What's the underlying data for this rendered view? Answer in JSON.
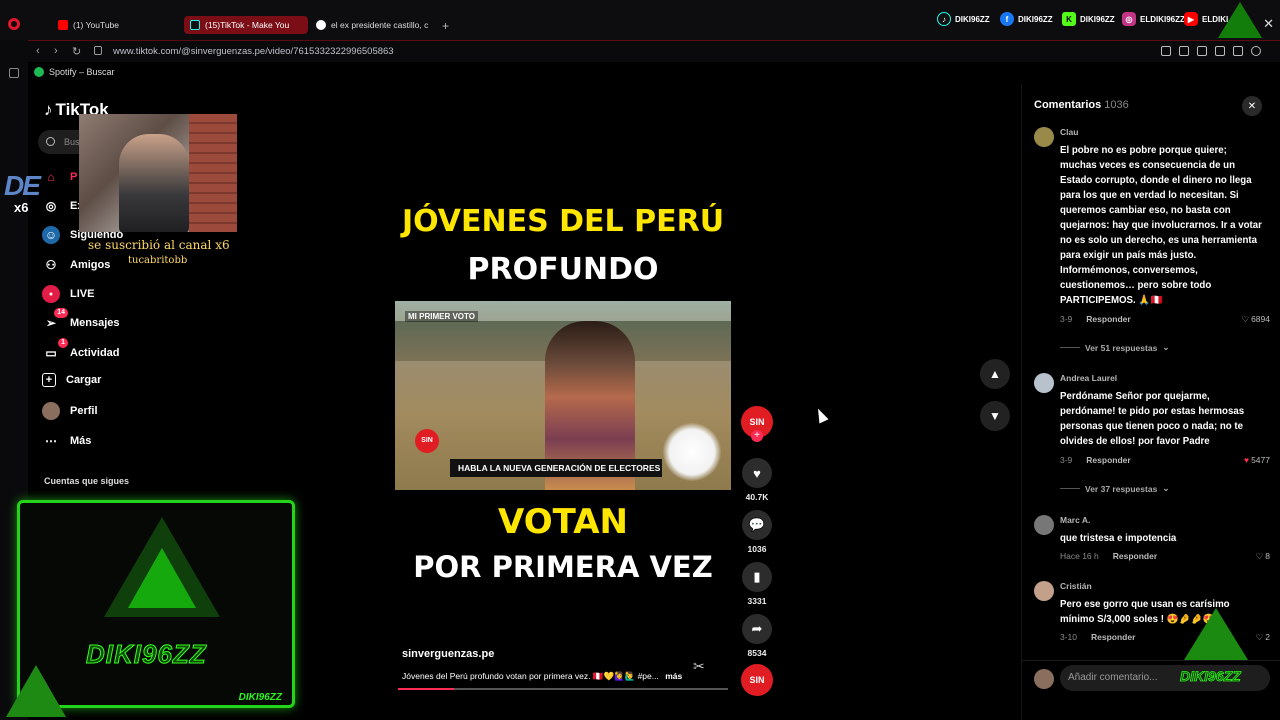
{
  "browser": {
    "tabs": [
      {
        "label": "(1) YouTube",
        "icon": "youtube-icon",
        "active": false
      },
      {
        "label": "(15)TikTok - Make You",
        "icon": "tiktok-icon",
        "active": true
      },
      {
        "label": "el ex presidente castillo, c",
        "icon": "google-icon",
        "active": false
      }
    ],
    "url": "www.tiktok.com/@sinverguenzas.pe/video/7615332322996505863",
    "bookmark": "Spotify – Buscar",
    "socials": [
      {
        "icon": "tiktok-icon",
        "label": "DIKI96ZZ",
        "color": "#111111"
      },
      {
        "icon": "facebook-icon",
        "label": "DIKI96ZZ",
        "color": "#1877f2"
      },
      {
        "icon": "kick-icon",
        "label": "DIKI96ZZ",
        "color": "#53fc18"
      },
      {
        "icon": "instagram-icon",
        "label": "ELDIKI96ZZ",
        "color": "#c13584"
      },
      {
        "icon": "youtube-icon",
        "label": "ELDIKI",
        "color": "#ff0000"
      }
    ]
  },
  "tiktok": {
    "logo": "TikTok",
    "search_placeholder": "Bus",
    "nav": [
      {
        "label": "P",
        "icon": "home-icon",
        "badge": ""
      },
      {
        "label": "Ex",
        "icon": "compass-icon",
        "badge": ""
      },
      {
        "label": "Siguiendo",
        "icon": "following-icon",
        "badge": ""
      },
      {
        "label": "Amigos",
        "icon": "friends-icon",
        "badge": ""
      },
      {
        "label": "LIVE",
        "icon": "live-icon",
        "badge": ""
      },
      {
        "label": "Mensajes",
        "icon": "messages-icon",
        "badge": "14"
      },
      {
        "label": "Actividad",
        "icon": "activity-icon",
        "badge": "1"
      },
      {
        "label": "Cargar",
        "icon": "upload-icon",
        "badge": ""
      },
      {
        "label": "Perfil",
        "icon": "profile-icon",
        "badge": ""
      },
      {
        "label": "Más",
        "icon": "more-icon",
        "badge": ""
      }
    ],
    "following_title": "Cuentas que sigues"
  },
  "overlay": {
    "sub_alert": "se suscribió al canal x6",
    "sub_user": "tucabritobb",
    "x6_big": "DE",
    "x6_small": "x6",
    "frame_name": "DIKI96ZZ",
    "frame_small": "DIKI96ZZ",
    "corner_name": "DIKI96ZZ"
  },
  "video": {
    "line1": "JÓVENES DEL PERÚ",
    "line2": "PROFUNDO",
    "line3": "VOTAN",
    "line4": "POR PRIMERA VEZ",
    "lower_third": "HABLA LA NUEVA GENERACIÓN DE ELECTORES",
    "logo_text": "SIN",
    "corner_text": "MI PRIMER VOTO",
    "author": "sinverguenzas.pe",
    "description": "Jóvenes del Perú profundo votan por primera vez. 🇵🇪💛🙋‍♀️🙋‍♂️ #pe...",
    "more": "más",
    "progress": 0.17
  },
  "actions": {
    "avatar_text": "SIN",
    "likes": "40.7K",
    "comments": "1036",
    "saves": "3331",
    "shares": "8534"
  },
  "comments": {
    "title": "Comentarios",
    "count": "1036",
    "reply_label": "Responder",
    "items": [
      {
        "user": "Clau",
        "text": "El pobre no es pobre porque quiere; muchas veces es consecuencia de un Estado corrupto, donde el dinero no llega para los que en verdad lo necesitan. Si queremos cambiar eso, no basta con quejarnos: hay que involucrarnos. Ir a votar no es solo un derecho, es una herramienta para exigir un país más justo. Informémonos, conversemos, cuestionemos… pero sobre todo PARTICIPEMOS. 🙏🇵🇪",
        "date": "3-9",
        "likes": "6894",
        "replies": "Ver 51 respuestas"
      },
      {
        "user": "Andrea Laurel",
        "text": "Perdóname Señor por quejarme, perdóname! te pido por estas hermosas personas que tienen poco o nada; no te olvides de ellos! por favor Padre",
        "date": "3-9",
        "likes": "5477",
        "replies": "Ver 37 respuestas"
      },
      {
        "user": "Marc A.",
        "text": "que tristesa e impotencia",
        "date": "Hace 16 h",
        "likes": "8",
        "replies": ""
      },
      {
        "user": "Cristián",
        "text": "Pero ese gorro que usan es carísimo mínimo S/3,000 soles ! 😍🤌🤌😍",
        "date": "3-10",
        "likes": "2",
        "replies": ""
      }
    ],
    "add_placeholder": "Añadir comentario..."
  }
}
